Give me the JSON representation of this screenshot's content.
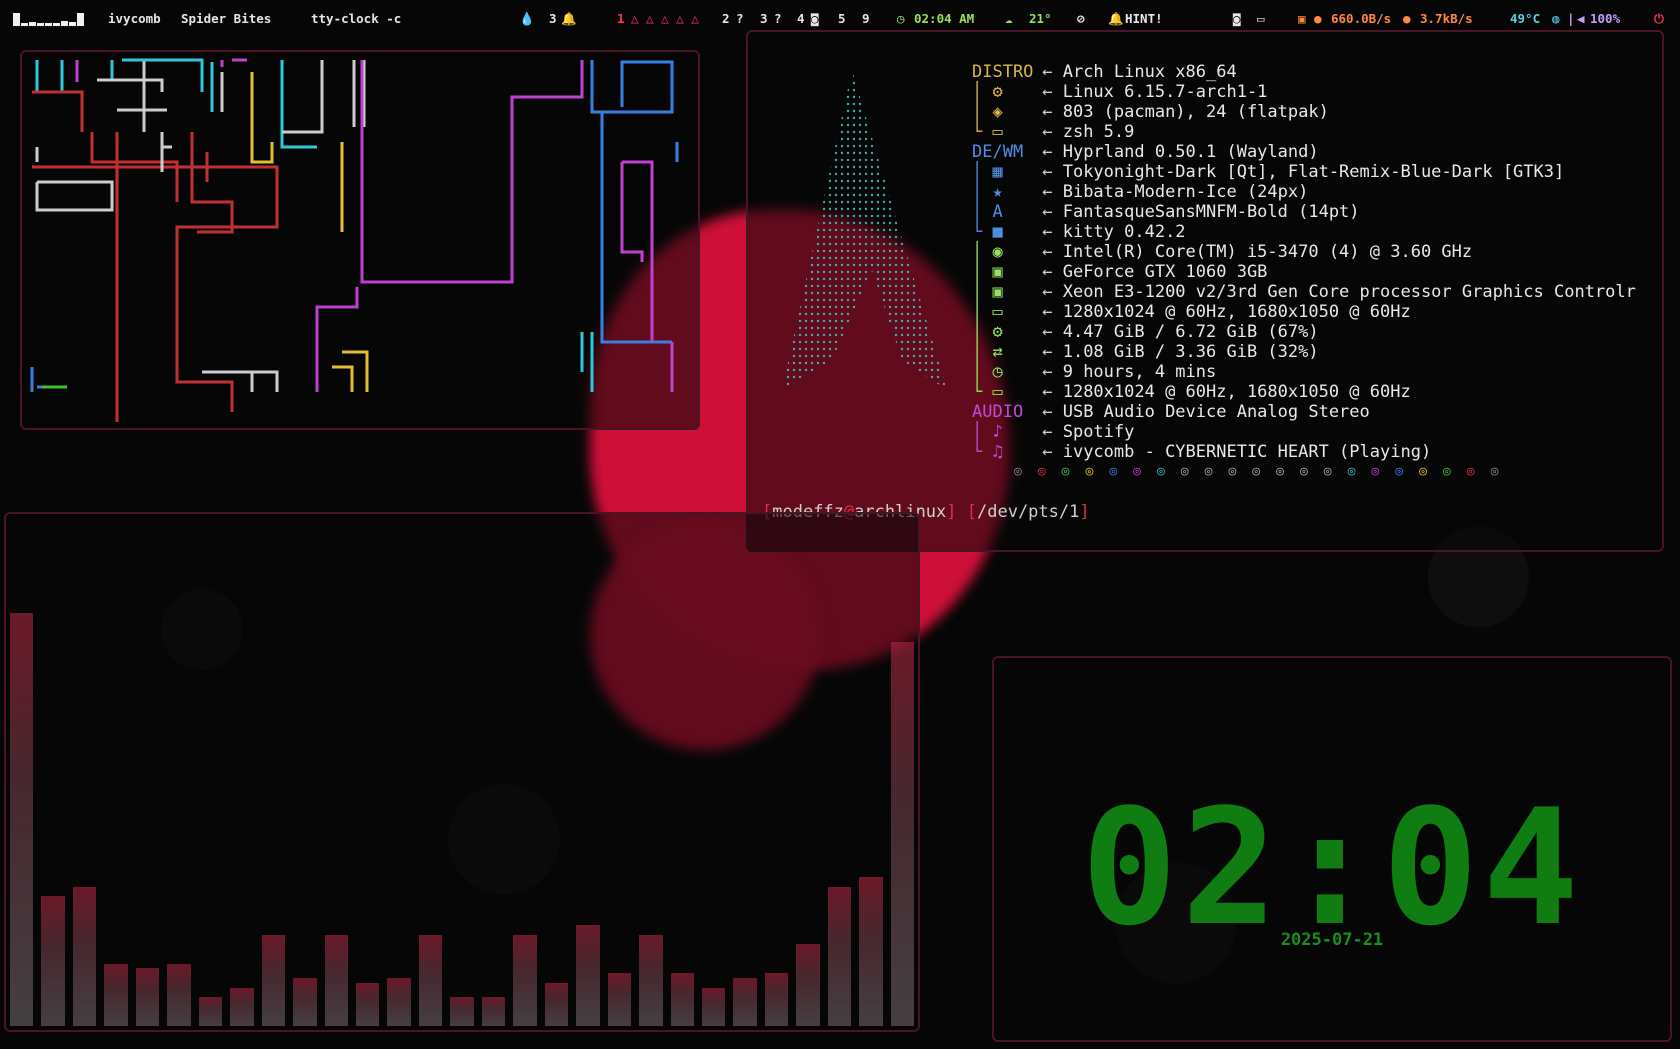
{
  "topbar": {
    "active_app": "ivycomb",
    "window_title": "Spider Bites",
    "command": "tty-clock -c",
    "notif_count": "3",
    "workspaces": [
      "1",
      "2",
      "3",
      "4",
      "5",
      "9"
    ],
    "clock": "02:04 AM",
    "weather": "21°",
    "hint": "HINT!",
    "net_down": "660.0B/s",
    "net_up": "3.7kB/s",
    "temp": "49°C",
    "volume": "100%",
    "colors": {
      "accent": "#ff3355",
      "green": "#98e060",
      "cyan": "#55d0e0"
    }
  },
  "fastfetch": {
    "rows": [
      {
        "key": "DISTRO",
        "value": "Arch Linux x86_64"
      },
      {
        "key": "",
        "value": "Linux 6.15.7-arch1-1"
      },
      {
        "key": "",
        "value": "803 (pacman), 24 (flatpak)"
      },
      {
        "key": "",
        "value": "zsh 5.9"
      },
      {
        "key": "DE/WM",
        "value": "Hyprland 0.50.1 (Wayland)"
      },
      {
        "key": "",
        "value": "Tokyonight-Dark [Qt], Flat-Remix-Blue-Dark [GTK3]"
      },
      {
        "key": "",
        "value": "Bibata-Modern-Ice (24px)"
      },
      {
        "key": "",
        "value": "FantasqueSansMNFM-Bold (14pt)"
      },
      {
        "key": "",
        "value": "kitty 0.42.2"
      },
      {
        "key": "",
        "value": "Intel(R) Core(TM) i5-3470 (4) @ 3.60 GHz"
      },
      {
        "key": "",
        "value": "GeForce GTX 1060 3GB"
      },
      {
        "key": "",
        "value": "Xeon E3-1200 v2/3rd Gen Core processor Graphics Controlr"
      },
      {
        "key": "",
        "value": "1280x1024 @ 60Hz, 1680x1050 @ 60Hz"
      },
      {
        "key": "",
        "value": "4.47 GiB / 6.72 GiB (67%)"
      },
      {
        "key": "",
        "value": "1.08 GiB / 3.36 GiB (32%)"
      },
      {
        "key": "",
        "value": "9 hours, 4 mins"
      },
      {
        "key": "",
        "value": "1280x1024 @ 60Hz, 1680x1050 @ 60Hz"
      },
      {
        "key": "AUDIO",
        "value": "USB Audio Device Analog Stereo"
      },
      {
        "key": "",
        "value": "Spotify"
      },
      {
        "key": "",
        "value": "ivycomb - CYBERNETIC HEART (Playing)"
      }
    ],
    "prompt_user": "modeffz",
    "prompt_host": "archlinux",
    "prompt_tty": "/dev/pts/1"
  },
  "visualizer": {
    "levels": [
      0.86,
      0.27,
      0.29,
      0.13,
      0.12,
      0.13,
      0.06,
      0.08,
      0.19,
      0.1,
      0.19,
      0.09,
      0.1,
      0.19,
      0.06,
      0.06,
      0.19,
      0.09,
      0.21,
      0.11,
      0.19,
      0.11,
      0.08,
      0.1,
      0.11,
      0.17,
      0.29,
      0.31,
      0.8
    ]
  },
  "tty_clock": {
    "time": "02:04",
    "date": "2025-07-21"
  }
}
